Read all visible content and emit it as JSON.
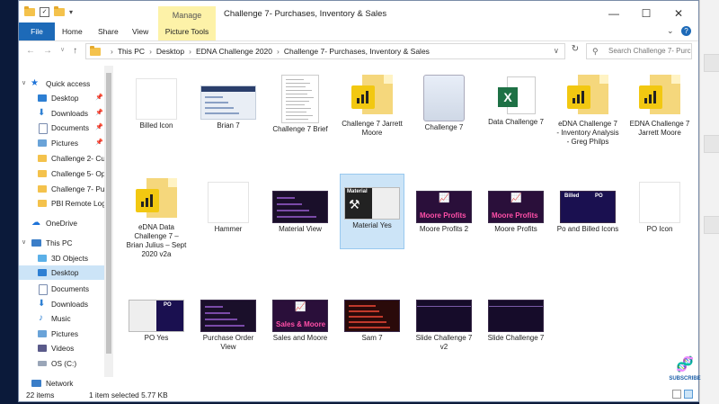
{
  "window": {
    "title": "Challenge 7- Purchases, Inventory & Sales",
    "manage_tab": "Manage",
    "controls": {
      "minimize": "—",
      "maximize": "☐",
      "close": "✕"
    }
  },
  "ribbon": {
    "tabs": [
      "File",
      "Home",
      "Share",
      "View",
      "Picture Tools"
    ],
    "expand": "⌄",
    "help": "?"
  },
  "address": {
    "breadcrumbs": [
      "This PC",
      "Desktop",
      "EDNA Challenge 2020",
      "Challenge 7- Purchases, Inventory & Sales"
    ],
    "search_placeholder": "Search Challenge 7- Purchas..."
  },
  "nav_pane": {
    "quick_access": "Quick access",
    "quick_items": [
      "Desktop",
      "Downloads",
      "Documents",
      "Pictures",
      "Challenge 2- Cu",
      "Challenge 5- Op",
      "Challenge 7- Pu",
      "PBI Remote Logi"
    ],
    "onedrive": "OneDrive",
    "this_pc": "This PC",
    "pc_items": [
      "3D Objects",
      "Desktop",
      "Documents",
      "Downloads",
      "Music",
      "Pictures",
      "Videos",
      "OS (C:)"
    ],
    "network": "Network"
  },
  "files": [
    {
      "name": "Billed Icon",
      "kind": "white"
    },
    {
      "name": "Brian 7",
      "kind": "screenshot"
    },
    {
      "name": "Challenge 7 Brief",
      "kind": "doc"
    },
    {
      "name": "Challenge 7 Jarrett Moore",
      "kind": "pbix"
    },
    {
      "name": "Challenge 7",
      "kind": "notes"
    },
    {
      "name": "Data Challenge 7",
      "kind": "excel"
    },
    {
      "name": "eDNA Challenge 7 - Inventory Analysis - Greg Philps",
      "kind": "pbix"
    },
    {
      "name": "EDNA Challenge 7 Jarrett Moore",
      "kind": "pbix"
    },
    {
      "name": "eDNA Data Challenge 7 – Brian Julius – Sept 2020 v2a",
      "kind": "pbix"
    },
    {
      "name": "Hammer",
      "kind": "white"
    },
    {
      "name": "Material View",
      "kind": "dark"
    },
    {
      "name": "Material Yes",
      "kind": "material",
      "thumb_label": "Material",
      "selected": true
    },
    {
      "name": "Moore Profits 2",
      "kind": "profits",
      "thumb_label": "Moore Profits"
    },
    {
      "name": "Moore Profits",
      "kind": "profits",
      "thumb_label": "Moore Profits"
    },
    {
      "name": "Po and Billed Icons",
      "kind": "pobilled",
      "thumb_label_a": "Billed",
      "thumb_label_b": "PO"
    },
    {
      "name": "PO Icon",
      "kind": "white"
    },
    {
      "name": "PO Yes",
      "kind": "poyes",
      "thumb_label": "PO"
    },
    {
      "name": "Purchase Order View",
      "kind": "dark"
    },
    {
      "name": "Sales and Moore",
      "kind": "salesmoore",
      "thumb_label": "Sales & Moore"
    },
    {
      "name": "Sam 7",
      "kind": "sam"
    },
    {
      "name": "Slide Challenge 7 v2",
      "kind": "slide"
    },
    {
      "name": "Slide Challenge 7",
      "kind": "slide"
    }
  ],
  "status": {
    "count": "22 items",
    "selection": "1 item selected  5.77 KB"
  },
  "overlay": {
    "subscribe": "SUBSCRIBE"
  }
}
